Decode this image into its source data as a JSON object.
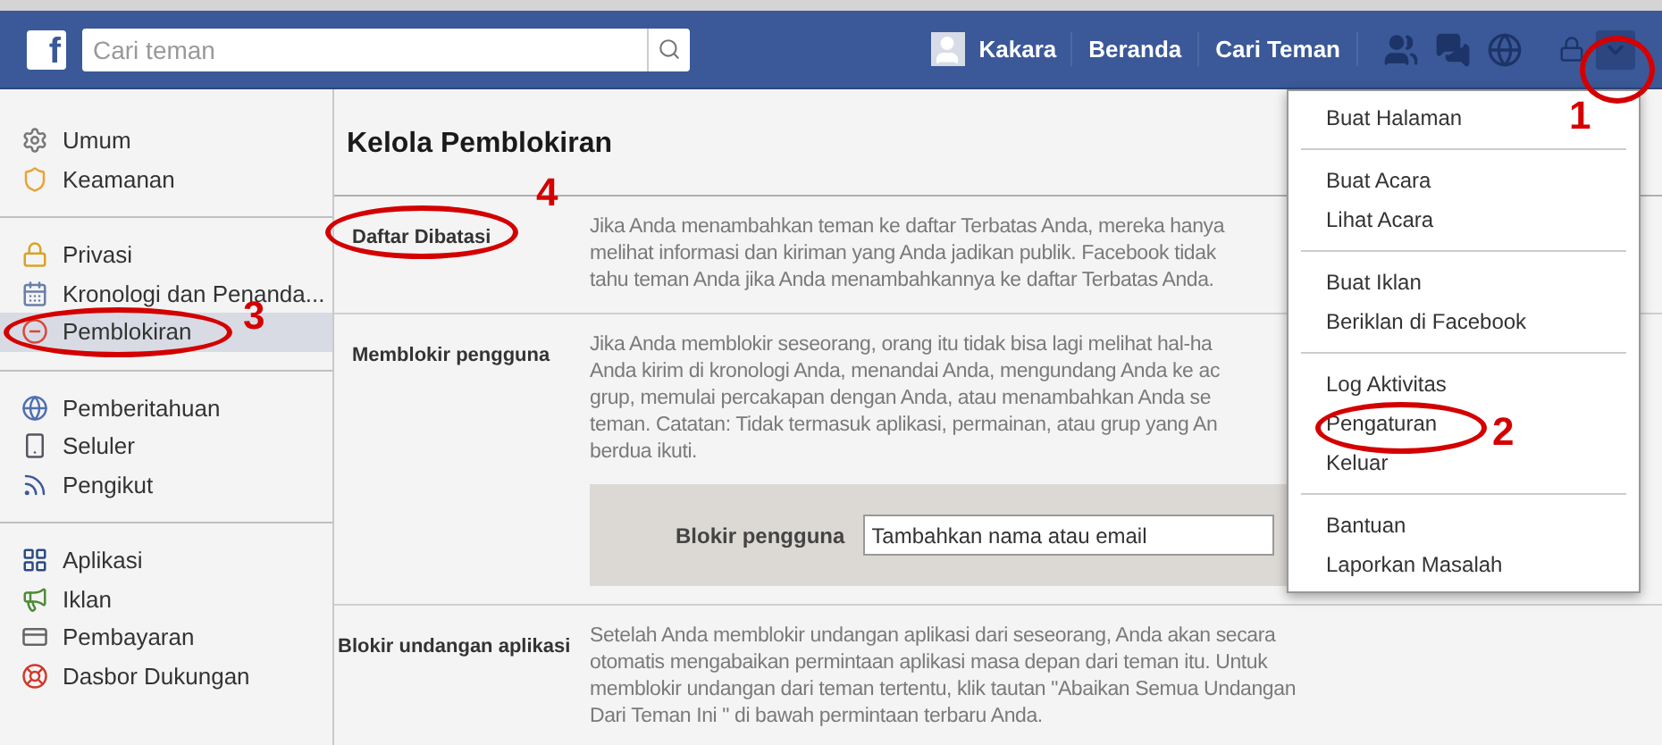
{
  "topbar": {
    "logo": "f",
    "search": {
      "placeholder": "Cari teman"
    },
    "profile": "Kakara",
    "nav": [
      "Beranda",
      "Cari Teman"
    ],
    "menu_open": true
  },
  "sidebar": {
    "groups": [
      [
        {
          "label": "Umum",
          "selected": false
        },
        {
          "label": "Keamanan",
          "selected": false
        }
      ],
      [
        {
          "label": "Privasi",
          "selected": false
        },
        {
          "label": "Kronologi dan Penanda...",
          "selected": false
        },
        {
          "label": "Pemblokiran",
          "selected": true
        }
      ],
      [
        {
          "label": "Pemberitahuan",
          "selected": false
        },
        {
          "label": "Seluler",
          "selected": false
        },
        {
          "label": "Pengikut",
          "selected": false
        }
      ],
      [
        {
          "label": "Aplikasi",
          "selected": false
        },
        {
          "label": "Iklan",
          "selected": false
        },
        {
          "label": "Pembayaran",
          "selected": false
        },
        {
          "label": "Dasbor Dukungan",
          "selected": false
        }
      ]
    ]
  },
  "main": {
    "title": "Kelola Pemblokiran",
    "sections": [
      {
        "label": "Daftar Dibatasi",
        "lines": [
          "Jika Anda menambahkan teman ke daftar Terbatas Anda, mereka hanya",
          "melihat informasi dan kiriman yang Anda jadikan publik. Facebook tidak",
          "tahu teman Anda jika Anda menambahkannya ke daftar Terbatas Anda."
        ]
      },
      {
        "label": "Memblokir pengguna",
        "lines": [
          "Jika Anda memblokir seseorang, orang itu tidak bisa lagi melihat hal-ha",
          "Anda kirim di kronologi Anda, menandai Anda, mengundang Anda ke ac",
          "grup, memulai percakapan dengan Anda, atau menambahkan Anda se",
          "teman. Catatan: Tidak termasuk aplikasi, permainan, atau grup yang An",
          "berdua ikuti."
        ],
        "form": {
          "label": "Blokir pengguna",
          "placeholder": "Tambahkan nama atau email"
        }
      },
      {
        "label": "Blokir undangan aplikasi",
        "lines": [
          "Setelah Anda memblokir undangan aplikasi dari seseorang, Anda akan secara",
          "otomatis mengabaikan permintaan aplikasi masa depan dari teman itu. Untuk",
          "memblokir undangan dari teman tertentu, klik tautan \"Abaikan Semua Undangan",
          "Dari Teman Ini \" di bawah permintaan terbaru Anda."
        ]
      }
    ]
  },
  "dropdown": {
    "groups": [
      [
        "Buat Halaman"
      ],
      [
        "Buat Acara",
        "Lihat Acara"
      ],
      [
        "Buat Iklan",
        "Beriklan di Facebook"
      ],
      [
        "Log Aktivitas",
        "Pengaturan",
        "Keluar"
      ],
      [
        "Bantuan",
        "Laporkan Masalah"
      ]
    ]
  },
  "annotations": [
    {
      "label": "1"
    },
    {
      "label": "2"
    },
    {
      "label": "3"
    },
    {
      "label": "4"
    }
  ]
}
